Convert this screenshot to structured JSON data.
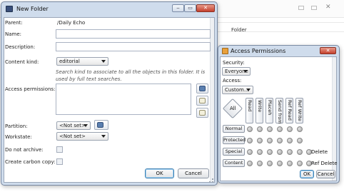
{
  "background_app": {
    "folder_header": "Folder"
  },
  "new_folder": {
    "title": "New Folder",
    "parent_label": "Parent:",
    "parent_value": "/Daily Echo",
    "name_label": "Name:",
    "name_value": "",
    "description_label": "Description:",
    "description_value": "",
    "content_kind_label": "Content kind:",
    "content_kind_value": "editorial",
    "content_kind_hint": "Search kind to associate to all the objects in this folder. It is used by full text searches.",
    "access_permissions_label": "Access permissions:",
    "partition_label": "Partition:",
    "partition_value": "<Not set>",
    "workstate_label": "Workstate:",
    "workstate_value": "<Not set>",
    "do_not_archive_label": "Do not archive:",
    "do_not_archive_checked": false,
    "create_carbon_copy_label": "Create carbon copy:",
    "create_carbon_copy_checked": false,
    "ok_label": "OK",
    "cancel_label": "Cancel"
  },
  "access_permissions": {
    "title": "Access Permissions",
    "security_label": "Security:",
    "security_value": "Everyone",
    "access_label": "Access:",
    "access_value": "Custom...",
    "all_label": "All",
    "columns": [
      "Read",
      "Write",
      "Placeholder",
      "Send from",
      "Ref Read",
      "Ref Write"
    ],
    "column_labels_shown": [
      "Read",
      "Write",
      "Placeh",
      "Send from",
      "Ref Read",
      "Ref Write"
    ],
    "rows": [
      "Normal",
      "Protected",
      "Special",
      "Content"
    ],
    "special_extra": "Delete",
    "content_extra": "Ref Delete",
    "ok_label": "OK",
    "cancel_label": "Cancel"
  }
}
